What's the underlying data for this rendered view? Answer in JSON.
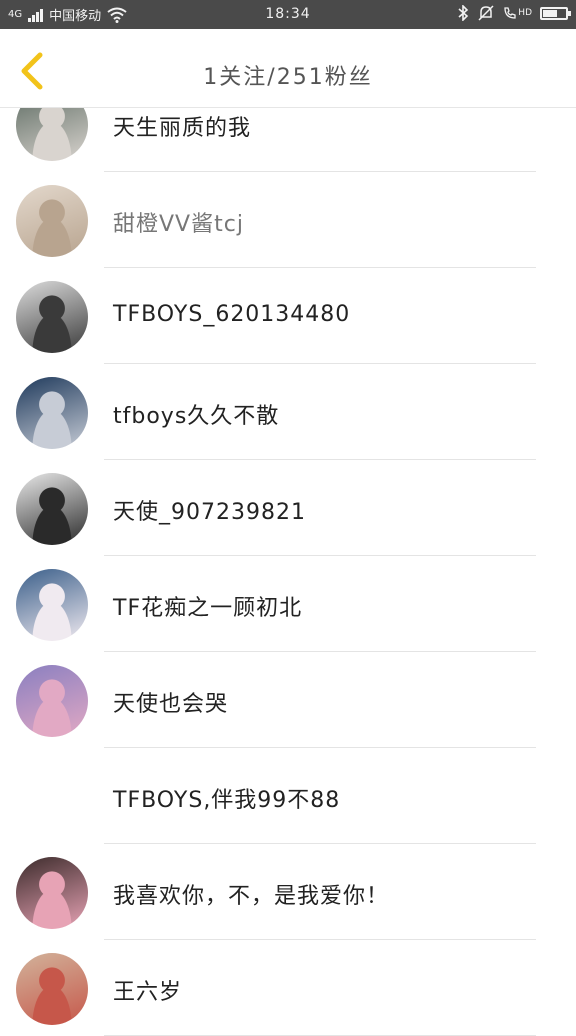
{
  "status_bar": {
    "network_badge": "4G",
    "carrier": "中国移动",
    "time": "18:34",
    "hd_badge": "HD",
    "battery_level": 0.62
  },
  "header": {
    "title": "1关注/251粉丝"
  },
  "users": [
    {
      "name": "天生丽质的我",
      "avatar_colors": [
        "#5d6b62",
        "#d9d4cf"
      ]
    },
    {
      "name": "甜橙VV酱tcj",
      "avatar_colors": [
        "#e3d8cc",
        "#b8a48f"
      ]
    },
    {
      "name": "TFBOYS_620134480",
      "avatar_colors": [
        "#dcdcdc",
        "#3a3a3a"
      ]
    },
    {
      "name": "tfboys久久不散",
      "avatar_colors": [
        "#1f3a5c",
        "#c7ccd6"
      ]
    },
    {
      "name": "天使_907239821",
      "avatar_colors": [
        "#e9e9e9",
        "#2a2a2a"
      ]
    },
    {
      "name": "TF花痴之一顾初北",
      "avatar_colors": [
        "#3b5f8a",
        "#f0eaf0"
      ]
    },
    {
      "name": "天使也会哭",
      "avatar_colors": [
        "#8a7fc0",
        "#e2a9c4"
      ]
    },
    {
      "name": "TFBOYS,伴我99不88",
      "avatar_colors": []
    },
    {
      "name": "我喜欢你，不，是我爱你！",
      "avatar_colors": [
        "#3c2b2b",
        "#e7a3b5"
      ]
    },
    {
      "name": "王六岁",
      "avatar_colors": [
        "#d2b39b",
        "#c6574a"
      ]
    }
  ]
}
